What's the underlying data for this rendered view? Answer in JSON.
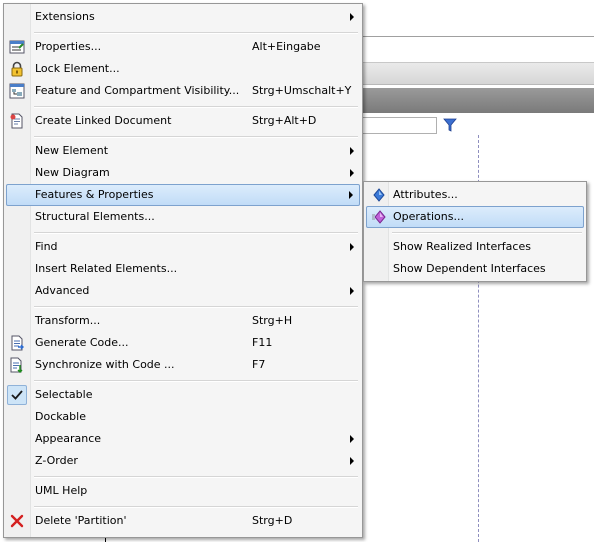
{
  "menu": {
    "items": [
      {
        "label": "Extensions",
        "shortcut": "",
        "submenu": true,
        "icon": ""
      },
      {
        "label": "Properties...",
        "shortcut": "Alt+Eingabe",
        "submenu": false,
        "icon": "properties-icon"
      },
      {
        "label": "Lock Element...",
        "shortcut": "",
        "submenu": false,
        "icon": "lock-icon"
      },
      {
        "label": "Feature and Compartment Visibility...",
        "shortcut": "Strg+Umschalt+Y",
        "submenu": false,
        "icon": "visibility-icon"
      },
      {
        "label": "Create Linked Document",
        "shortcut": "Strg+Alt+D",
        "submenu": false,
        "icon": "linked-document-icon"
      },
      {
        "label": "New Element",
        "shortcut": "",
        "submenu": true,
        "icon": ""
      },
      {
        "label": "New Diagram",
        "shortcut": "",
        "submenu": true,
        "icon": ""
      },
      {
        "label": "Features & Properties",
        "shortcut": "",
        "submenu": true,
        "icon": "",
        "highlighted": true
      },
      {
        "label": "Structural Elements...",
        "shortcut": "",
        "submenu": false,
        "icon": ""
      },
      {
        "label": "Find",
        "shortcut": "",
        "submenu": true,
        "icon": ""
      },
      {
        "label": "Insert Related Elements...",
        "shortcut": "",
        "submenu": false,
        "icon": ""
      },
      {
        "label": "Advanced",
        "shortcut": "",
        "submenu": true,
        "icon": ""
      },
      {
        "label": "Transform...",
        "shortcut": "Strg+H",
        "submenu": false,
        "icon": ""
      },
      {
        "label": "Generate Code...",
        "shortcut": "F11",
        "submenu": false,
        "icon": "generate-code-icon"
      },
      {
        "label": "Synchronize with Code ...",
        "shortcut": "F7",
        "submenu": false,
        "icon": "synchronize-icon"
      },
      {
        "label": "Selectable",
        "shortcut": "",
        "submenu": false,
        "icon": "checkmark-icon",
        "checked": true
      },
      {
        "label": "Dockable",
        "shortcut": "",
        "submenu": false,
        "icon": ""
      },
      {
        "label": "Appearance",
        "shortcut": "",
        "submenu": true,
        "icon": ""
      },
      {
        "label": "Z-Order",
        "shortcut": "",
        "submenu": true,
        "icon": ""
      },
      {
        "label": "UML Help",
        "shortcut": "",
        "submenu": false,
        "icon": ""
      },
      {
        "label": "Delete 'Partition'",
        "shortcut": "Strg+D",
        "submenu": false,
        "icon": "delete-icon"
      }
    ]
  },
  "submenu": {
    "items": [
      {
        "label": "Attributes...",
        "icon": "attributes-icon"
      },
      {
        "label": "Operations...",
        "icon": "operations-icon",
        "highlighted": true
      },
      {
        "label": "Show Realized Interfaces",
        "icon": ""
      },
      {
        "label": "Show Dependent Interfaces",
        "icon": ""
      }
    ]
  },
  "colors": {
    "highlight_border": "#7da2ce",
    "highlight_fill": "#c1dcf7",
    "delete_icon": "#d42020",
    "check_fill": "#cde4f7"
  }
}
